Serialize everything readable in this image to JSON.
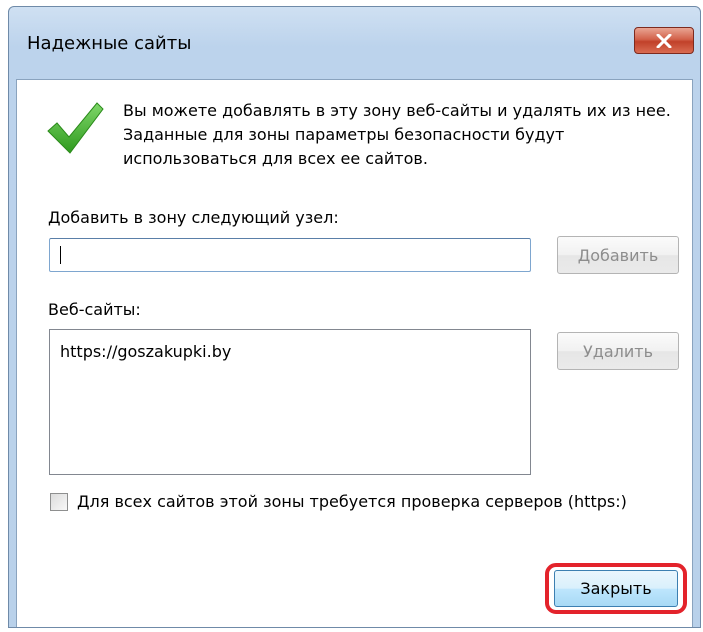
{
  "window": {
    "title": "Надежные сайты"
  },
  "icons": {
    "info": "checkmark-icon",
    "close": "close-icon"
  },
  "info_text": "Вы можете добавлять в эту зону  веб-сайты и удалять их из нее. Заданные для зоны параметры безопасности будут использоваться для всех ее сайтов.",
  "add_zone": {
    "label": "Добавить в зону следующий узел:",
    "value": "",
    "button_label": "Добавить"
  },
  "websites": {
    "label": "Веб-сайты:",
    "items": [
      "https://goszakupki.by"
    ],
    "remove_button_label": "Удалить"
  },
  "https_check": {
    "label": "Для всех сайтов этой зоны требуется проверка серверов (https:)",
    "checked": false
  },
  "close_button_label": "Закрыть",
  "colors": {
    "highlight": "#e3232b",
    "check_green": "#3fae2a"
  }
}
